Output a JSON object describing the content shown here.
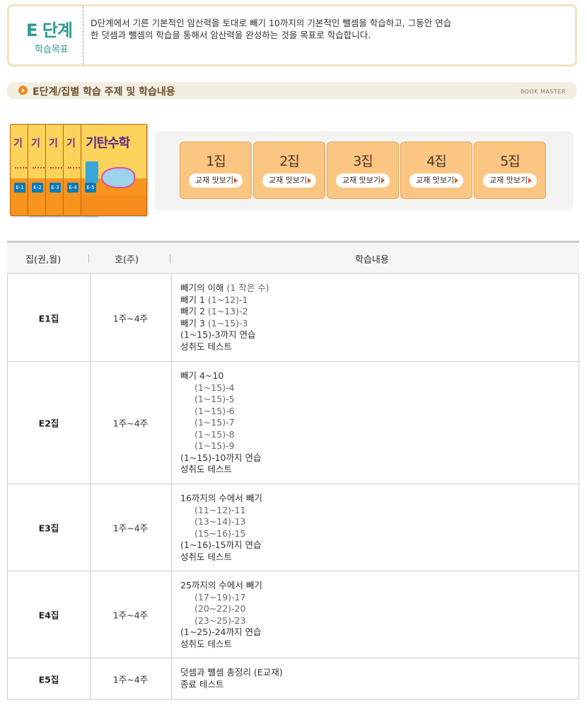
{
  "goal": {
    "stage": "E 단계",
    "label": "학습목표",
    "text": "D단계에서 기른 기본적인 암산력을 토대로 빼기 10까지의 기본적인 뺄셈을 학습하고, 그동안 연습한 덧셈과 뺄셈의 학습을 통해서 암산력을 완성하는 것을 목표로 학습합니다."
  },
  "section": {
    "title": "E단계/집별 학습 주제 및 학습내용",
    "brand": "BOOK MASTER"
  },
  "books": {
    "front_title": "기탄수학",
    "tabs": [
      "E-1",
      "E-2",
      "E-3",
      "E-4",
      "E-5"
    ]
  },
  "volumes": [
    {
      "label": "1집",
      "preview": "교재 맛보기"
    },
    {
      "label": "2집",
      "preview": "교재 맛보기"
    },
    {
      "label": "3집",
      "preview": "교재 맛보기"
    },
    {
      "label": "4집",
      "preview": "교재 맛보기"
    },
    {
      "label": "5집",
      "preview": "교재 맛보기"
    }
  ],
  "table": {
    "headers": [
      "집(권,월)",
      "호(주)",
      "학습내용"
    ],
    "rows": [
      {
        "vol": "E1집",
        "weeks": "1주~4주",
        "lines": [
          {
            "text": "빼기의 이해",
            "sub": "(1 작은 수)",
            "indent": false
          },
          {
            "text": "빼기 1",
            "sub": "(1~12)-1",
            "indent": false
          },
          {
            "text": "빼기 2",
            "sub": "(1~13)-2",
            "indent": false
          },
          {
            "text": "빼기 3",
            "sub": "(1~15)-3",
            "indent": false
          },
          {
            "text": "(1~15)-3까지 연습",
            "sub": "",
            "indent": false
          },
          {
            "text": "성취도 테스트",
            "sub": "",
            "indent": false
          }
        ]
      },
      {
        "vol": "E2집",
        "weeks": "1주~4주",
        "lines": [
          {
            "text": "빼기 4~10",
            "sub": "",
            "indent": false
          },
          {
            "text": "(1~15)-4",
            "sub": "",
            "indent": true
          },
          {
            "text": "(1~15)-5",
            "sub": "",
            "indent": true
          },
          {
            "text": "(1~15)-6",
            "sub": "",
            "indent": true
          },
          {
            "text": "(1~15)-7",
            "sub": "",
            "indent": true
          },
          {
            "text": "(1~15)-8",
            "sub": "",
            "indent": true
          },
          {
            "text": "(1~15)-9",
            "sub": "",
            "indent": true
          },
          {
            "text": "(1~15)-10까지 연습",
            "sub": "",
            "indent": false
          },
          {
            "text": "성취도 테스트",
            "sub": "",
            "indent": false
          }
        ]
      },
      {
        "vol": "E3집",
        "weeks": "1주~4주",
        "lines": [
          {
            "text": "16까지의 수에서 빼기",
            "sub": "",
            "indent": false
          },
          {
            "text": "(11~12)-11",
            "sub": "",
            "indent": true
          },
          {
            "text": "(13~14)-13",
            "sub": "",
            "indent": true
          },
          {
            "text": "(15~16)-15",
            "sub": "",
            "indent": true
          },
          {
            "text": "(1~16)-15까지 연습",
            "sub": "",
            "indent": false
          },
          {
            "text": "성취도 테스트",
            "sub": "",
            "indent": false
          }
        ]
      },
      {
        "vol": "E4집",
        "weeks": "1주~4주",
        "lines": [
          {
            "text": "25까지의 수에서 빼기",
            "sub": "",
            "indent": false
          },
          {
            "text": "(17~19)-17",
            "sub": "",
            "indent": true
          },
          {
            "text": "(20~22)-20",
            "sub": "",
            "indent": true
          },
          {
            "text": "(23~25)-23",
            "sub": "",
            "indent": true
          },
          {
            "text": "(1~25)-24까지 연습",
            "sub": "",
            "indent": false
          },
          {
            "text": "성취도 테스트",
            "sub": "",
            "indent": false
          }
        ]
      },
      {
        "vol": "E5집",
        "weeks": "1주~4주",
        "lines": [
          {
            "text": "덧셈과 뺄셈 총정리 (E교재)",
            "sub": "",
            "indent": false
          },
          {
            "text": "종료 테스트",
            "sub": "",
            "indent": false
          }
        ]
      }
    ]
  },
  "colors": {
    "accent": "#f28a1c",
    "teal": "#2a9a8e",
    "button": "#fbc582"
  }
}
